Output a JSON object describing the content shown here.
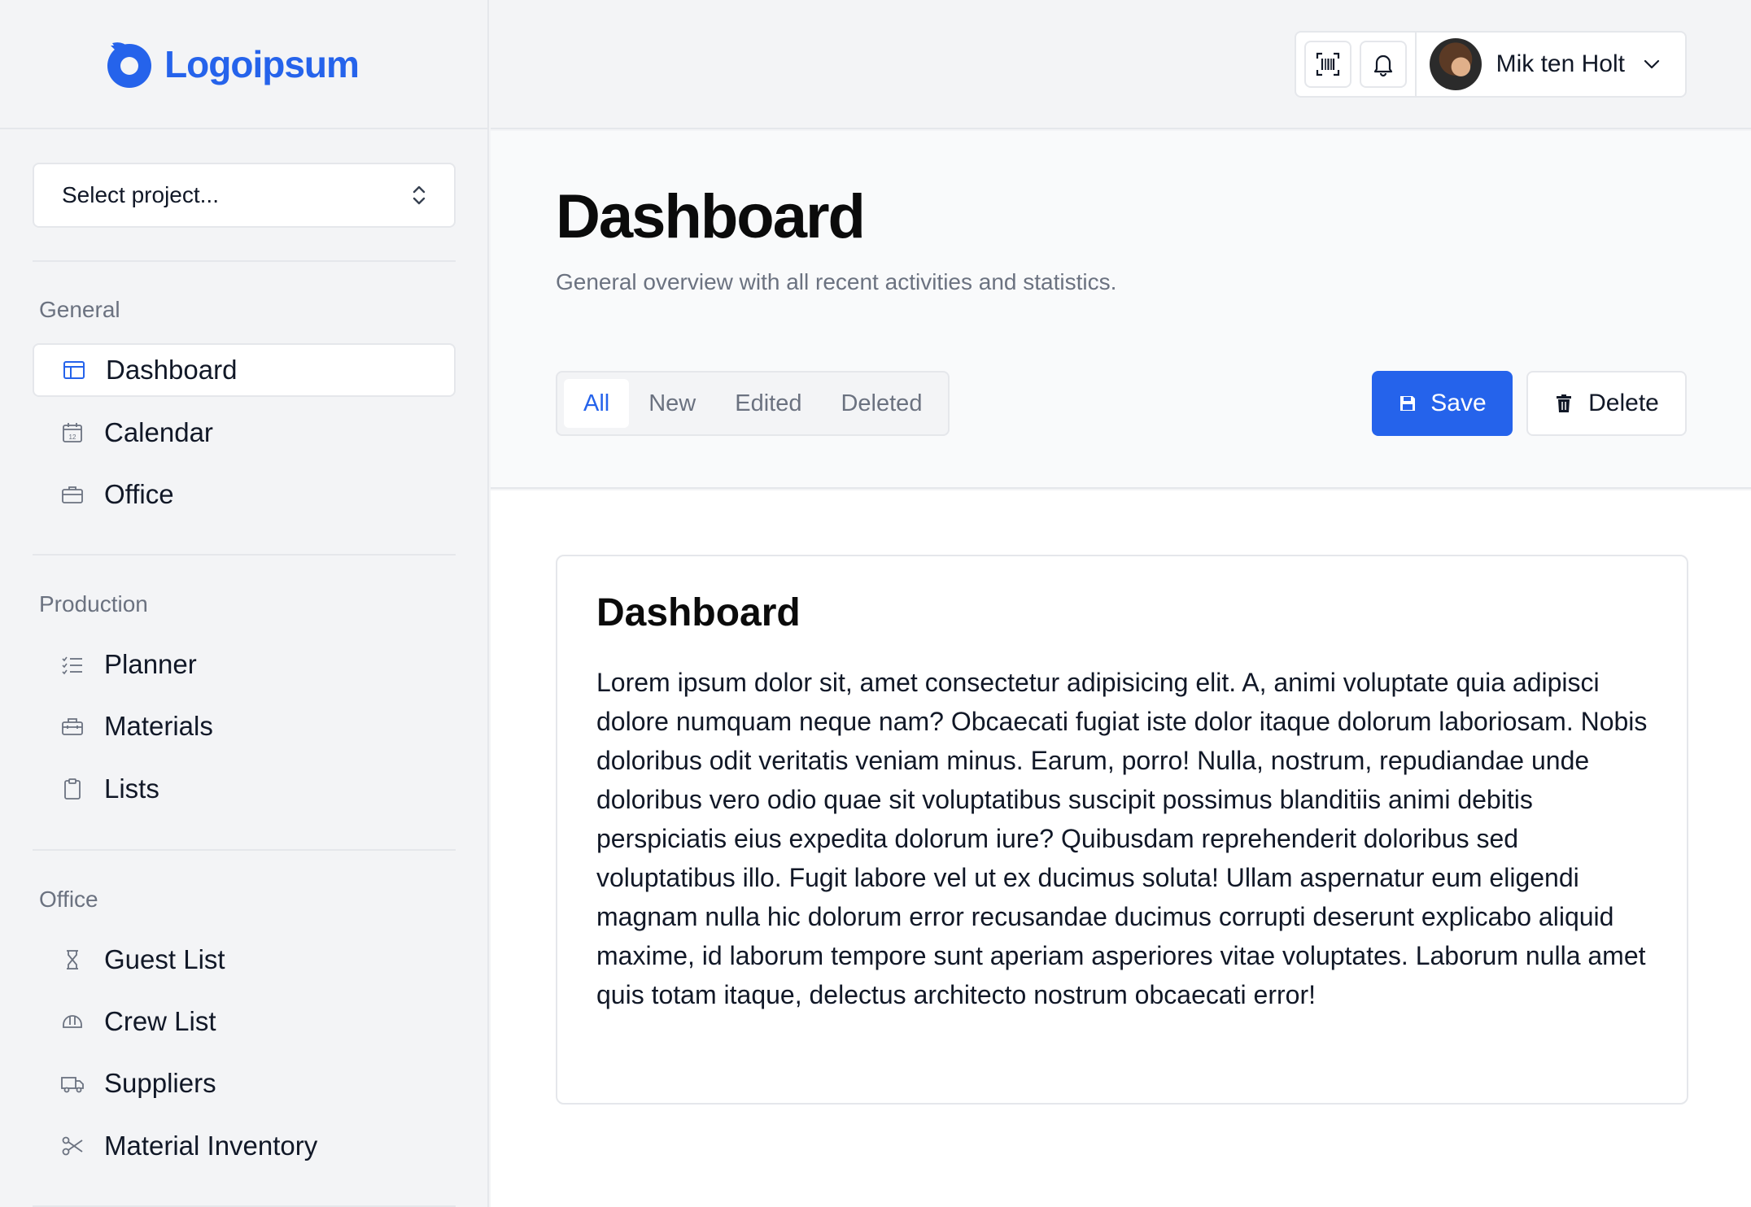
{
  "brand": {
    "name": "Logoipsum",
    "color": "#2563eb"
  },
  "sidebar": {
    "project_select": {
      "label": "Select project...",
      "icon": "chevrons-up-down-icon"
    },
    "sections": [
      {
        "title": "General",
        "items": [
          {
            "label": "Dashboard",
            "icon": "layout-icon",
            "active": true
          },
          {
            "label": "Calendar",
            "icon": "calendar-icon"
          },
          {
            "label": "Office",
            "icon": "briefcase-icon"
          }
        ]
      },
      {
        "title": "Production",
        "items": [
          {
            "label": "Planner",
            "icon": "list-checks-icon"
          },
          {
            "label": "Materials",
            "icon": "toolbox-icon"
          },
          {
            "label": "Lists",
            "icon": "clipboard-icon"
          }
        ]
      },
      {
        "title": "Office",
        "items": [
          {
            "label": "Guest List",
            "icon": "hourglass-icon"
          },
          {
            "label": "Crew List",
            "icon": "hard-hat-icon"
          },
          {
            "label": "Suppliers",
            "icon": "truck-icon"
          },
          {
            "label": "Material Inventory",
            "icon": "scissors-icon"
          }
        ]
      }
    ]
  },
  "topbar": {
    "scan_icon": "barcode-scan-icon",
    "notification_icon": "bell-icon",
    "user": {
      "name": "Mik ten Holt",
      "menu_icon": "chevron-down-icon"
    }
  },
  "header": {
    "title": "Dashboard",
    "subtitle": "General overview with all recent activities and statistics.",
    "tabs": [
      {
        "label": "All",
        "active": true
      },
      {
        "label": "New"
      },
      {
        "label": "Edited"
      },
      {
        "label": "Deleted"
      }
    ],
    "actions": {
      "save_label": "Save",
      "delete_label": "Delete"
    }
  },
  "card": {
    "title": "Dashboard",
    "body": "Lorem ipsum dolor sit, amet consectetur adipisicing elit. A, animi voluptate quia adipisci dolore numquam neque nam? Obcaecati fugiat iste dolor itaque dolorum laboriosam. Nobis doloribus odit veritatis veniam minus. Earum, porro! Nulla, nostrum, repudiandae unde doloribus vero odio quae sit voluptatibus suscipit possimus blanditiis animi debitis perspiciatis eius expedita dolorum iure? Quibusdam reprehenderit doloribus sed voluptatibus illo. Fugit labore vel ut ex ducimus soluta! Ullam aspernatur eum eligendi magnam nulla hic dolorum error recusandae ducimus corrupti deserunt explicabo aliquid maxime, id laborum tempore sunt aperiam asperiores vitae voluptates. Laborum nulla amet quis totam itaque, delectus architecto nostrum obcaecati error!"
  },
  "colors": {
    "accent": "#2563eb",
    "sidebar_bg": "#f3f4f6",
    "border": "#e5e7eb",
    "muted_text": "#6b7280"
  }
}
